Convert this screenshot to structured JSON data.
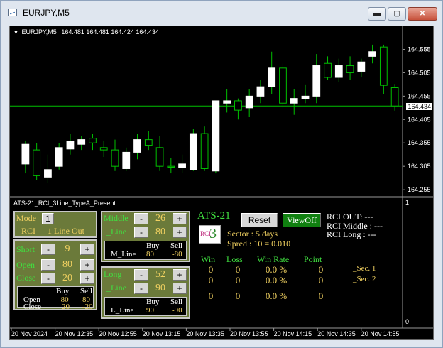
{
  "window": {
    "title": "EURJPY,M5",
    "controls": {
      "minimize": "▬",
      "maximize": "▢",
      "close": "✕"
    }
  },
  "chart": {
    "symbol": "EURJPY,M5",
    "ohlc": "164.481 164.481 164.424 164.434",
    "current_price": "164.434",
    "subwindow_title": "ATS-21_RCI_3Line_TypeA_Present",
    "subwindow_axis": [
      "1",
      "0"
    ],
    "colors": {
      "bull": "#ffffff",
      "bear": "#000000",
      "wick": "#00c000",
      "grid": "#00c000"
    }
  },
  "chart_data": {
    "type": "candlestick",
    "title": "EURJPY,M5",
    "ylim": [
      164.24,
      164.58
    ],
    "y_ticks": [
      "164.555",
      "164.505",
      "164.455",
      "164.405",
      "164.355",
      "164.305",
      "164.255"
    ],
    "y_tick_values": [
      164.555,
      164.505,
      164.455,
      164.405,
      164.355,
      164.305,
      164.255
    ],
    "x_ticks": [
      "20 Nov 2024",
      "20 Nov 12:35",
      "20 Nov 12:55",
      "20 Nov 13:15",
      "20 Nov 13:35",
      "20 Nov 13:55",
      "20 Nov 14:15",
      "20 Nov 14:35",
      "20 Nov 14:55"
    ],
    "current_price": 164.434,
    "candles": [
      {
        "o": 164.31,
        "h": 164.36,
        "l": 164.29,
        "c": 164.352
      },
      {
        "o": 164.34,
        "h": 164.355,
        "l": 164.275,
        "c": 164.285
      },
      {
        "o": 164.282,
        "h": 164.33,
        "l": 164.27,
        "c": 164.298
      },
      {
        "o": 164.305,
        "h": 164.355,
        "l": 164.298,
        "c": 164.345
      },
      {
        "o": 164.342,
        "h": 164.375,
        "l": 164.33,
        "c": 164.358
      },
      {
        "o": 164.352,
        "h": 164.37,
        "l": 164.34,
        "c": 164.362
      },
      {
        "o": 164.365,
        "h": 164.375,
        "l": 164.34,
        "c": 164.355
      },
      {
        "o": 164.345,
        "h": 164.36,
        "l": 164.325,
        "c": 164.34
      },
      {
        "o": 164.34,
        "h": 164.362,
        "l": 164.295,
        "c": 164.305
      },
      {
        "o": 164.3,
        "h": 164.345,
        "l": 164.295,
        "c": 164.335
      },
      {
        "o": 164.335,
        "h": 164.375,
        "l": 164.32,
        "c": 164.362
      },
      {
        "o": 164.362,
        "h": 164.38,
        "l": 164.34,
        "c": 164.35
      },
      {
        "o": 164.345,
        "h": 164.37,
        "l": 164.295,
        "c": 164.305
      },
      {
        "o": 164.305,
        "h": 164.322,
        "l": 164.29,
        "c": 164.303
      },
      {
        "o": 164.303,
        "h": 164.33,
        "l": 164.29,
        "c": 164.31
      },
      {
        "o": 164.298,
        "h": 164.385,
        "l": 164.295,
        "c": 164.375
      },
      {
        "o": 164.375,
        "h": 164.39,
        "l": 164.295,
        "c": 164.3
      },
      {
        "o": 164.295,
        "h": 164.405,
        "l": 164.29,
        "c": 164.445
      },
      {
        "o": 164.44,
        "h": 164.47,
        "l": 164.42,
        "c": 164.445
      },
      {
        "o": 164.445,
        "h": 164.45,
        "l": 164.405,
        "c": 164.425
      },
      {
        "o": 164.43,
        "h": 164.47,
        "l": 164.41,
        "c": 164.455
      },
      {
        "o": 164.455,
        "h": 164.49,
        "l": 164.44,
        "c": 164.475
      },
      {
        "o": 164.475,
        "h": 164.55,
        "l": 164.46,
        "c": 164.515
      },
      {
        "o": 164.515,
        "h": 164.525,
        "l": 164.43,
        "c": 164.44
      },
      {
        "o": 164.44,
        "h": 164.47,
        "l": 164.415,
        "c": 164.45
      },
      {
        "o": 164.45,
        "h": 164.48,
        "l": 164.44,
        "c": 164.455
      },
      {
        "o": 164.455,
        "h": 164.545,
        "l": 164.44,
        "c": 164.52
      },
      {
        "o": 164.525,
        "h": 164.54,
        "l": 164.49,
        "c": 164.495
      },
      {
        "o": 164.495,
        "h": 164.535,
        "l": 164.485,
        "c": 164.52
      },
      {
        "o": 164.52,
        "h": 164.54,
        "l": 164.49,
        "c": 164.505
      },
      {
        "o": 164.508,
        "h": 164.535,
        "l": 164.495,
        "c": 164.528
      },
      {
        "o": 164.54,
        "h": 164.565,
        "l": 164.525,
        "c": 164.55
      },
      {
        "o": 164.56,
        "h": 164.565,
        "l": 164.46,
        "c": 164.478
      },
      {
        "o": 164.473,
        "h": 164.481,
        "l": 164.424,
        "c": 164.434
      }
    ]
  },
  "panel": {
    "mode": {
      "label": "Mode",
      "value": "1",
      "rci": "RCI",
      "rci_value": "1 Line Out"
    },
    "short": {
      "label": "Short",
      "minus": "-",
      "plus": "+",
      "value": "9"
    },
    "open": {
      "label": "Open",
      "minus": "-",
      "plus": "+",
      "value": "80"
    },
    "close": {
      "label": "Close",
      "minus": "-",
      "plus": "+",
      "value": "20"
    },
    "short_table": {
      "buy": "Buy",
      "sell": "Sell",
      "open_label": "Open",
      "open_buy": "-80",
      "open_sell": "80",
      "close_label": "Close",
      "close_buy": "20",
      "close_sell": "-20"
    },
    "middle": {
      "label": "Middle",
      "minus": "-",
      "plus": "+",
      "value": "26",
      "line_label": "_Line",
      "line_value": "80"
    },
    "middle_table": {
      "buy": "Buy",
      "sell": "Sell",
      "row_label": "M_Line",
      "buy_val": "80",
      "sell_val": "-80"
    },
    "long": {
      "label": "Long",
      "minus": "-",
      "plus": "+",
      "value": "52",
      "line_label": "_Line",
      "line_value": "90"
    },
    "long_table": {
      "buy": "Buy",
      "sell": "Sell",
      "row_label": "L_Line",
      "buy_val": "90",
      "sell_val": "-90"
    },
    "ats_title": "ATS-21",
    "reset_label": "Reset",
    "viewoff_label": "ViewOff",
    "rci_out": "RCI OUT: ---",
    "rci_middle": "RCI Middle : ---",
    "rci_long": "RCI Long   : ---",
    "sector": "Sector : 5 days",
    "spred": "Spred : 10 = 0.010",
    "logo_text": "RCI",
    "logo_num": "3",
    "stats": {
      "headers": [
        "Win",
        "Loss",
        "Win Rate",
        "Point"
      ],
      "rows": [
        [
          "0",
          "0",
          "0.0 %",
          "0"
        ],
        [
          "0",
          "0",
          "0.0 %",
          "0"
        ]
      ],
      "total": [
        "0",
        "0",
        "0.0 %",
        "0"
      ],
      "sec1": "_Sec. 1",
      "sec2": "_Sec. 2"
    }
  }
}
